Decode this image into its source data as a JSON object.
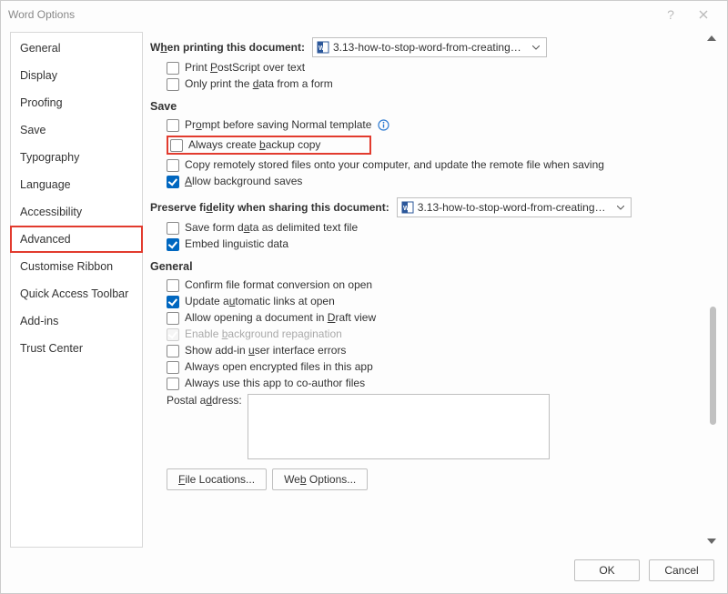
{
  "window": {
    "title": "Word Options"
  },
  "sidebar": {
    "items": [
      {
        "label": "General"
      },
      {
        "label": "Display"
      },
      {
        "label": "Proofing"
      },
      {
        "label": "Save"
      },
      {
        "label": "Typography"
      },
      {
        "label": "Language"
      },
      {
        "label": "Accessibility"
      },
      {
        "label": "Advanced",
        "highlighted": true
      },
      {
        "label": "Customise Ribbon"
      },
      {
        "label": "Quick Access Toolbar"
      },
      {
        "label": "Add-ins"
      },
      {
        "label": "Trust Center"
      }
    ]
  },
  "printing": {
    "label_pre": "W",
    "label_u": "h",
    "label_post": "en printing this document:",
    "doc_name": "3.13-how-to-stop-word-from-creating-b...",
    "postscript_pre": "Print ",
    "postscript_u": "P",
    "postscript_post": "ostScript over text",
    "only_data_pre": "Only print the ",
    "only_data_u": "d",
    "only_data_post": "ata from a form"
  },
  "save": {
    "title": "Save",
    "prompt_pre": "Pr",
    "prompt_u": "o",
    "prompt_post": "mpt before saving Normal template",
    "backup_pre": "Always create ",
    "backup_u": "b",
    "backup_post": "ackup copy",
    "copy_remote": "Copy remotely stored files onto your computer, and update the remote file when saving",
    "bg_saves_pre": "",
    "bg_saves_u": "A",
    "bg_saves_post": "llow background saves"
  },
  "fidelity": {
    "label_pre": "Preserve fi",
    "label_u": "d",
    "label_post": "elity when sharing this document:",
    "doc_name": "3.13-how-to-stop-word-from-creating-b...",
    "save_form_pre": "Save form d",
    "save_form_u": "a",
    "save_form_post": "ta as delimited text file",
    "embed_ling": "Embed linguistic data"
  },
  "general": {
    "title": "General",
    "confirm_conv": "Confirm file format conversion on open",
    "auto_links_pre": "Update a",
    "auto_links_u": "u",
    "auto_links_post": "tomatic links at open",
    "draft_pre": "Allow opening a document in ",
    "draft_u": "D",
    "draft_post": "raft view",
    "bg_repag_pre": "Enable ",
    "bg_repag_u": "b",
    "bg_repag_post": "ackground repagination",
    "addin_err_pre": "Show add-in ",
    "addin_err_u": "u",
    "addin_err_post": "ser interface errors",
    "open_encrypted": "Always open encrypted files in this app",
    "coauthor": "Always use this app to co-author files",
    "postal_pre": "Postal a",
    "postal_u": "d",
    "postal_post": "dress:",
    "file_loc_pre": "",
    "file_loc_u": "F",
    "file_loc_post": "ile Locations...",
    "web_opt_pre": "We",
    "web_opt_u": "b",
    "web_opt_post": " Options..."
  },
  "buttons": {
    "ok": "OK",
    "cancel": "Cancel"
  }
}
